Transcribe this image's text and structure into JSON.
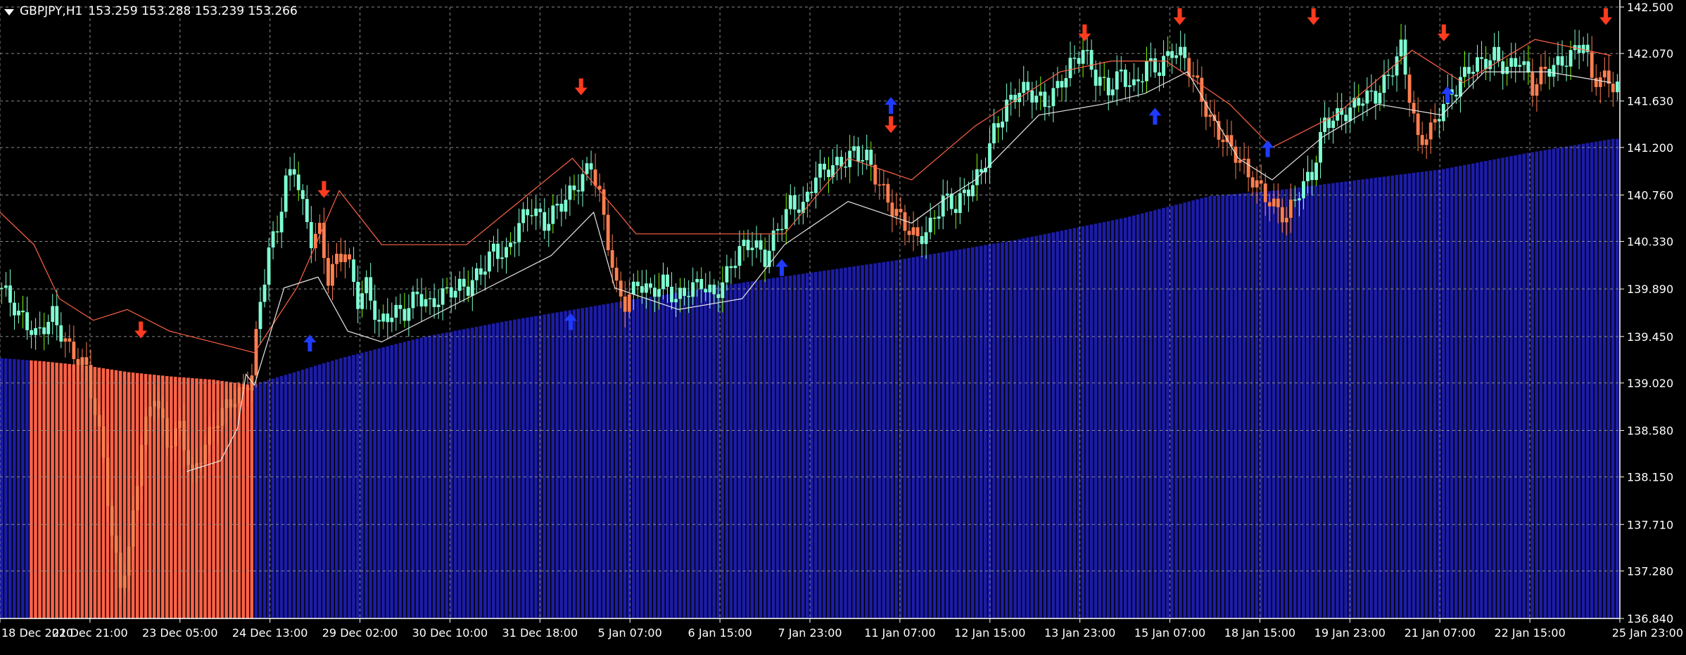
{
  "window": {
    "symbol_label": "GBPJPY,H1",
    "ohlc_label": "153.259 153.288 153.239 153.266"
  },
  "colors": {
    "background": "#000000",
    "grid": "#8a8a8a",
    "axis": "#ffffff",
    "bull_candle": "#7fffd4",
    "bear_candle": "#ff7f50",
    "green_wick": "#7cfc00",
    "blue_histogram": "#1c1ca8",
    "red_histogram": "#ff6347",
    "sell_arrow": "#ff3b1f",
    "buy_arrow": "#1f3bff",
    "trail_line": "#e6e6e6",
    "resistance_line": "#ff6347"
  },
  "chart_data": {
    "type": "candlestick",
    "y_axis": {
      "ticks": [
        "142.500",
        "142.070",
        "141.630",
        "141.200",
        "140.760",
        "140.330",
        "139.890",
        "139.450",
        "139.020",
        "138.580",
        "138.150",
        "137.710",
        "137.280",
        "136.840"
      ],
      "ylim": [
        136.84,
        142.5
      ],
      "position": "right"
    },
    "x_axis": {
      "ticks": [
        "18 Dec 2020",
        "21 Dec 21:00",
        "23 Dec 05:00",
        "24 Dec 13:00",
        "29 Dec 02:00",
        "30 Dec 10:00",
        "31 Dec 18:00",
        "5 Jan 07:00",
        "6 Jan 15:00",
        "7 Jan 23:00",
        "11 Jan 07:00",
        "12 Jan 15:00",
        "13 Jan 23:00",
        "15 Jan 07:00",
        "18 Jan 15:00",
        "19 Jan 23:00",
        "21 Jan 07:00",
        "22 Jan 15:00",
        "25 Jan 23:00"
      ]
    },
    "grid": true,
    "price_path": [
      [
        0,
        139.9
      ],
      [
        4,
        139.6
      ],
      [
        8,
        139.45
      ],
      [
        12,
        139.7
      ],
      [
        16,
        139.35
      ],
      [
        20,
        139.1
      ],
      [
        24,
        138.3
      ],
      [
        26,
        137.6
      ],
      [
        28,
        137.2
      ],
      [
        30,
        137.5
      ],
      [
        33,
        138.5
      ],
      [
        36,
        138.9
      ],
      [
        39,
        138.4
      ],
      [
        42,
        138.6
      ],
      [
        45,
        138.2
      ],
      [
        48,
        138.5
      ],
      [
        51,
        138.7
      ],
      [
        54,
        138.8
      ],
      [
        57,
        138.9
      ],
      [
        59,
        139.1
      ],
      [
        61,
        139.8
      ],
      [
        63,
        140.3
      ],
      [
        65,
        140.5
      ],
      [
        67,
        140.9
      ],
      [
        69,
        141.0
      ],
      [
        71,
        140.6
      ],
      [
        73,
        140.3
      ],
      [
        75,
        140.4
      ],
      [
        77,
        140.0
      ],
      [
        79,
        140.2
      ],
      [
        81,
        140.3
      ],
      [
        84,
        139.8
      ],
      [
        86,
        139.9
      ],
      [
        89,
        139.5
      ],
      [
        92,
        139.65
      ],
      [
        95,
        139.7
      ],
      [
        98,
        139.9
      ],
      [
        101,
        139.75
      ],
      [
        104,
        139.8
      ],
      [
        107,
        139.85
      ],
      [
        110,
        139.9
      ],
      [
        113,
        140.1
      ],
      [
        116,
        140.3
      ],
      [
        119,
        140.2
      ],
      [
        122,
        140.45
      ],
      [
        125,
        140.6
      ],
      [
        128,
        140.5
      ],
      [
        131,
        140.7
      ],
      [
        134,
        140.8
      ],
      [
        137,
        140.9
      ],
      [
        139,
        141.0
      ],
      [
        141,
        140.7
      ],
      [
        143,
        140.3
      ],
      [
        145,
        139.9
      ],
      [
        147,
        139.8
      ],
      [
        150,
        140.0
      ],
      [
        153,
        139.85
      ],
      [
        156,
        139.9
      ],
      [
        159,
        139.75
      ],
      [
        162,
        139.9
      ],
      [
        165,
        140.0
      ],
      [
        168,
        139.85
      ],
      [
        171,
        140.0
      ],
      [
        174,
        140.2
      ],
      [
        177,
        140.3
      ],
      [
        180,
        140.2
      ],
      [
        183,
        140.5
      ],
      [
        186,
        140.7
      ],
      [
        189,
        140.6
      ],
      [
        192,
        140.9
      ],
      [
        195,
        141.0
      ],
      [
        198,
        141.1
      ],
      [
        201,
        141.2
      ],
      [
        204,
        141.1
      ],
      [
        207,
        140.8
      ],
      [
        210,
        140.6
      ],
      [
        213,
        140.5
      ],
      [
        216,
        140.4
      ],
      [
        219,
        140.5
      ],
      [
        222,
        140.7
      ],
      [
        225,
        140.6
      ],
      [
        228,
        140.8
      ],
      [
        231,
        141.0
      ],
      [
        234,
        141.4
      ],
      [
        237,
        141.6
      ],
      [
        240,
        141.7
      ],
      [
        243,
        141.65
      ],
      [
        246,
        141.6
      ],
      [
        249,
        141.8
      ],
      [
        252,
        142.0
      ],
      [
        255,
        142.1
      ],
      [
        258,
        141.8
      ],
      [
        261,
        141.7
      ],
      [
        264,
        141.9
      ],
      [
        267,
        141.8
      ],
      [
        270,
        142.0
      ],
      [
        273,
        141.9
      ],
      [
        276,
        142.05
      ],
      [
        279,
        142.0
      ],
      [
        282,
        141.8
      ],
      [
        285,
        141.5
      ],
      [
        288,
        141.3
      ],
      [
        291,
        141.1
      ],
      [
        294,
        140.9
      ],
      [
        297,
        140.8
      ],
      [
        300,
        140.7
      ],
      [
        303,
        140.6
      ],
      [
        306,
        140.8
      ],
      [
        309,
        140.9
      ],
      [
        312,
        141.4
      ],
      [
        315,
        141.5
      ],
      [
        318,
        141.6
      ],
      [
        321,
        141.7
      ],
      [
        324,
        141.65
      ],
      [
        327,
        141.8
      ],
      [
        330,
        142.1
      ],
      [
        332,
        141.7
      ],
      [
        334,
        141.3
      ],
      [
        337,
        141.4
      ],
      [
        340,
        141.6
      ],
      [
        343,
        141.7
      ],
      [
        346,
        141.9
      ],
      [
        349,
        142.0
      ],
      [
        352,
        142.1
      ],
      [
        355,
        141.95
      ],
      [
        358,
        142.0
      ],
      [
        361,
        141.7
      ],
      [
        364,
        141.9
      ],
      [
        367,
        142.0
      ],
      [
        370,
        142.1
      ],
      [
        373,
        142.2
      ],
      [
        375,
        141.8
      ],
      [
        377,
        141.8
      ],
      [
        380,
        141.75
      ]
    ],
    "bear_segments": [
      [
        15,
        60
      ],
      [
        74,
        82
      ],
      [
        140,
        148
      ],
      [
        206,
        216
      ],
      [
        280,
        304
      ],
      [
        332,
        338
      ],
      [
        361,
        364
      ],
      [
        375,
        380
      ]
    ],
    "histogram_level": [
      [
        0,
        139.25
      ],
      [
        10,
        139.22
      ],
      [
        20,
        139.18
      ],
      [
        30,
        139.12
      ],
      [
        40,
        139.08
      ],
      [
        50,
        139.05
      ],
      [
        59,
        139.0
      ],
      [
        80,
        139.25
      ],
      [
        100,
        139.45
      ],
      [
        120,
        139.6
      ],
      [
        150,
        139.8
      ],
      [
        180,
        139.98
      ],
      [
        210,
        140.15
      ],
      [
        240,
        140.35
      ],
      [
        265,
        140.55
      ],
      [
        285,
        140.75
      ],
      [
        300,
        140.8
      ],
      [
        320,
        140.9
      ],
      [
        340,
        141.0
      ],
      [
        360,
        141.15
      ],
      [
        380,
        141.28
      ]
    ],
    "red_histogram_range": [
      7,
      59
    ],
    "sell_arrows": [
      [
        40,
        139.55
      ],
      [
        92,
        140.85
      ],
      [
        165,
        141.8
      ],
      [
        253,
        141.45
      ],
      [
        308,
        142.3
      ],
      [
        335,
        142.45
      ],
      [
        373,
        142.45
      ],
      [
        410,
        142.3
      ],
      [
        456,
        142.45
      ]
    ],
    "buy_arrows": [
      [
        88,
        139.35
      ],
      [
        162,
        139.55
      ],
      [
        222,
        140.05
      ],
      [
        253,
        141.55
      ],
      [
        328,
        141.45
      ],
      [
        360,
        141.15
      ],
      [
        411,
        141.65
      ]
    ],
    "trail_line": [
      [
        44,
        138.2
      ],
      [
        52,
        138.3
      ],
      [
        56,
        138.6
      ],
      [
        58,
        139.1
      ],
      [
        60,
        139.0
      ],
      [
        67,
        139.9
      ],
      [
        75,
        140.0
      ],
      [
        82,
        139.5
      ],
      [
        90,
        139.4
      ],
      [
        100,
        139.6
      ],
      [
        115,
        139.9
      ],
      [
        130,
        140.2
      ],
      [
        140,
        140.6
      ],
      [
        145,
        139.9
      ],
      [
        160,
        139.7
      ],
      [
        175,
        139.8
      ],
      [
        185,
        140.3
      ],
      [
        200,
        140.7
      ],
      [
        215,
        140.5
      ],
      [
        222,
        140.7
      ],
      [
        230,
        140.9
      ],
      [
        245,
        141.5
      ],
      [
        260,
        141.6
      ],
      [
        270,
        141.7
      ],
      [
        280,
        141.9
      ],
      [
        292,
        141.1
      ],
      [
        300,
        140.9
      ],
      [
        312,
        141.3
      ],
      [
        325,
        141.6
      ],
      [
        340,
        141.5
      ],
      [
        350,
        141.9
      ],
      [
        365,
        141.9
      ],
      [
        380,
        141.8
      ]
    ],
    "resistance_line": [
      [
        0,
        140.6
      ],
      [
        8,
        140.3
      ],
      [
        14,
        139.8
      ],
      [
        22,
        139.6
      ],
      [
        30,
        139.7
      ],
      [
        40,
        139.5
      ],
      [
        60,
        139.3
      ],
      [
        70,
        139.9
      ],
      [
        80,
        140.8
      ],
      [
        90,
        140.3
      ],
      [
        110,
        140.3
      ],
      [
        135,
        141.1
      ],
      [
        150,
        140.4
      ],
      [
        170,
        140.4
      ],
      [
        185,
        140.4
      ],
      [
        200,
        141.1
      ],
      [
        215,
        140.9
      ],
      [
        230,
        141.4
      ],
      [
        250,
        141.9
      ],
      [
        262,
        142.0
      ],
      [
        275,
        142.0
      ],
      [
        290,
        141.6
      ],
      [
        300,
        141.2
      ],
      [
        315,
        141.5
      ],
      [
        333,
        142.1
      ],
      [
        345,
        141.8
      ],
      [
        362,
        142.2
      ],
      [
        380,
        142.05
      ]
    ]
  }
}
